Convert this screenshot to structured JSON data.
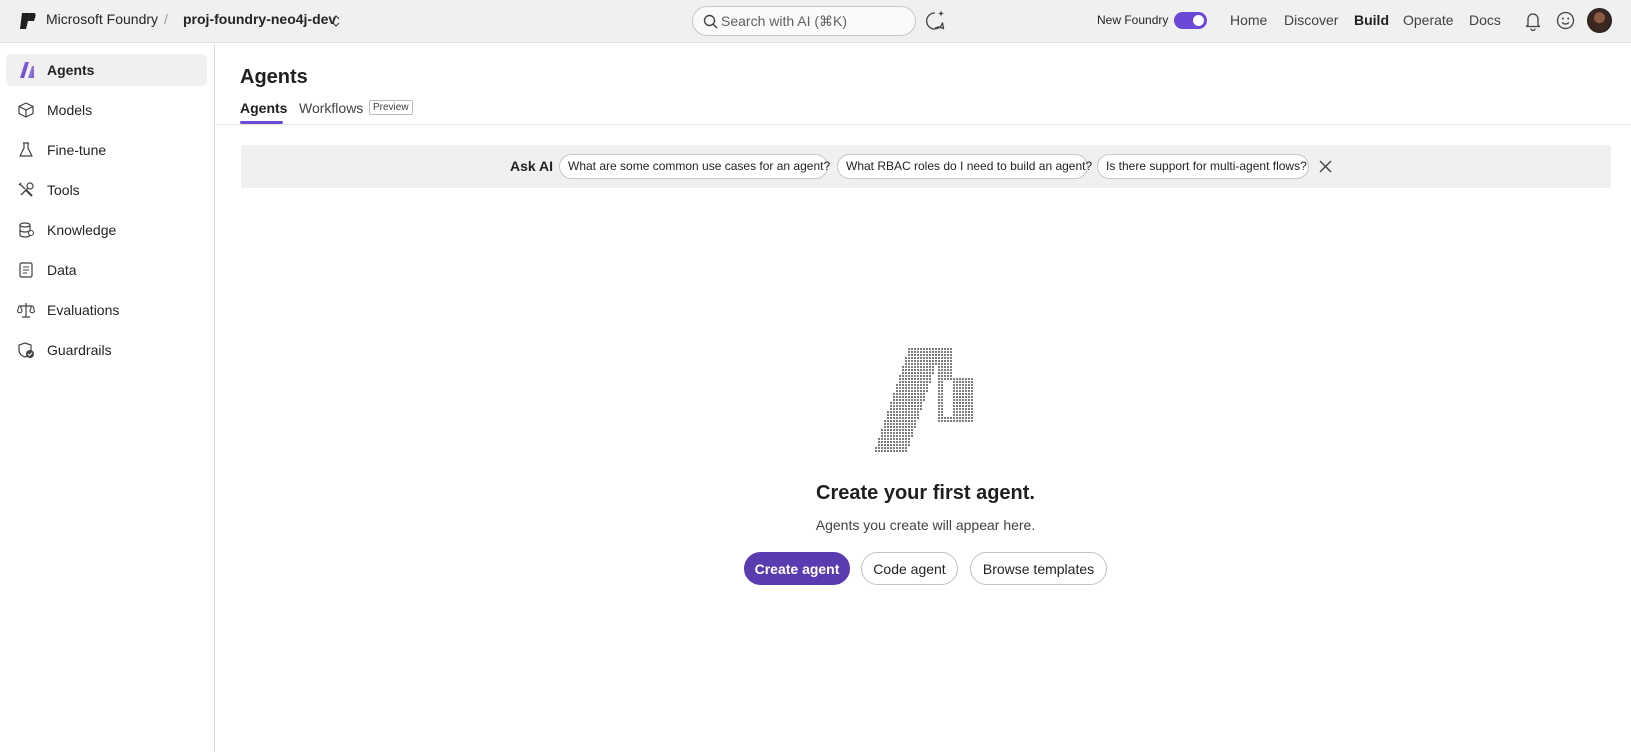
{
  "header": {
    "brand": "Microsoft Foundry",
    "separator": "/",
    "project": "proj-foundry-neo4j-dev",
    "search_placeholder": "Search with AI (⌘K)",
    "new_foundry_label": "New Foundry",
    "new_foundry_enabled": true,
    "nav": [
      "Home",
      "Discover",
      "Build",
      "Operate",
      "Docs"
    ],
    "nav_active": "Build",
    "icons": [
      "foundry-logo-icon",
      "chevron-updown-icon",
      "search-icon",
      "chat-spark-icon",
      "bell-icon",
      "smile-icon",
      "avatar"
    ]
  },
  "sidebar": {
    "items": [
      {
        "label": "Agents",
        "icon": "agents-icon",
        "active": true
      },
      {
        "label": "Models",
        "icon": "cube-icon",
        "active": false
      },
      {
        "label": "Fine-tune",
        "icon": "flask-icon",
        "active": false
      },
      {
        "label": "Tools",
        "icon": "wrench-icon",
        "active": false
      },
      {
        "label": "Knowledge",
        "icon": "database-icon",
        "active": false
      },
      {
        "label": "Data",
        "icon": "document-icon",
        "active": false
      },
      {
        "label": "Evaluations",
        "icon": "scales-icon",
        "active": false
      },
      {
        "label": "Guardrails",
        "icon": "shield-check-icon",
        "active": false
      }
    ]
  },
  "main": {
    "title": "Agents",
    "tabs": [
      {
        "label": "Agents",
        "active": true
      },
      {
        "label": "Workflows",
        "active": false,
        "badge": "Preview"
      }
    ],
    "ask_ai": {
      "label": "Ask AI",
      "suggestions": [
        "What are some common use cases for an agent?",
        "What RBAC roles do I need to build an agent?",
        "Is there support for multi-agent flows?"
      ]
    },
    "empty_state": {
      "title": "Create your first agent.",
      "subtitle": "Agents you create will appear here.",
      "buttons": {
        "create": "Create agent",
        "code": "Code agent",
        "browse": "Browse templates"
      }
    }
  },
  "colors": {
    "accent": "#6b48d6",
    "primary_button": "#5b3bb0",
    "topbar_bg": "#f0f0f0",
    "askai_bg": "#f0f0f0"
  }
}
